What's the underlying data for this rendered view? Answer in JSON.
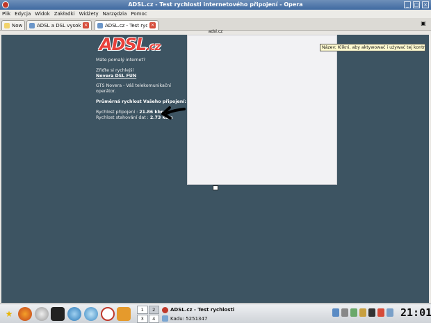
{
  "window": {
    "title": "ADSL.cz - Test rychlosti internetového připojení - Opera"
  },
  "menu": [
    "Plik",
    "Edycja",
    "Widok",
    "Zakładki",
    "Widżety",
    "Narzędzia",
    "Pomoc"
  ],
  "tabs": {
    "notes": "Nowa",
    "tab1": "ADSL a DSL vysokory...",
    "tab2": "ADSL.cz - Test rychlos..."
  },
  "address": "adsl.cz",
  "page": {
    "logo_main": "ADSL",
    "logo_tld": ".cz",
    "slow_question": "Máte pomalý internet?",
    "speedup": "Zřiďte si rychlejší",
    "speedup_link": "Novera DSL FUN",
    "operator": "GTS Novera - Váš telekomunikační operátor.",
    "avg_heading": "Průměrná rychlost Vašeho připojení:",
    "conn_label": "Rychlost připojení :",
    "conn_value": "21.86 kbps",
    "dl_label": "Rychlost stahování dat :",
    "dl_value": "2.73 kB/s",
    "tooltip": "Název: Klikni, aby aktywować i używać tej kontrolki"
  },
  "taskbar": {
    "pager": [
      "1",
      "2",
      "3",
      "4"
    ],
    "task_title": "ADSL.cz - Test rychlosti",
    "task_sub": "Kadu: 5251347",
    "clock": "21:01"
  },
  "colors": {
    "page_bg": "#3d5462",
    "brand_red": "#e8413b",
    "titlebar": "#4a73a6"
  },
  "icons": [
    "star-icon",
    "firefox-icon",
    "settings-icon",
    "terminal-icon",
    "network-icon",
    "globe-icon",
    "opera-icon",
    "files-icon"
  ]
}
